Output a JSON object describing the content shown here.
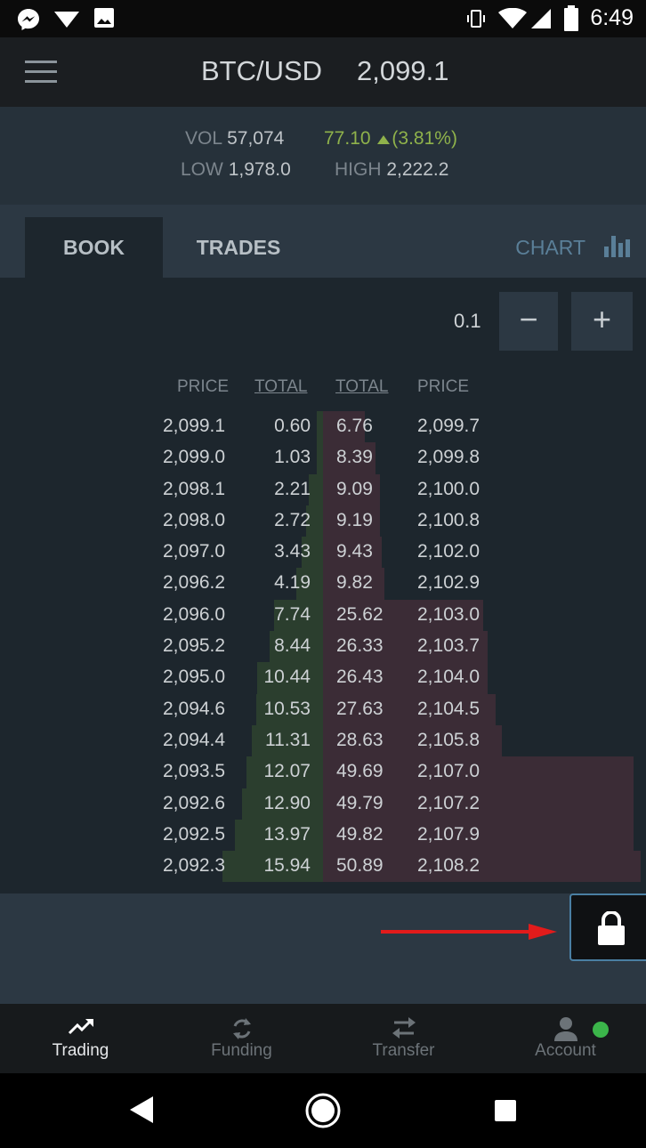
{
  "status_bar": {
    "time": "6:49"
  },
  "header": {
    "pair": "BTC/USD",
    "last_price": "2,099.1"
  },
  "stats": {
    "vol_label": "VOL",
    "vol_value": "57,074",
    "change": "77.10",
    "change_pct": "(3.81%)",
    "low_label": "LOW",
    "low_value": "1,978.0",
    "high_label": "HIGH",
    "high_value": "2,222.2"
  },
  "tabs": {
    "book": "BOOK",
    "trades": "TRADES",
    "chart": "CHART"
  },
  "precision": {
    "value": "0.1",
    "minus": "−",
    "plus": "+"
  },
  "columns": {
    "bid_price": "PRICE",
    "bid_total": "TOTAL",
    "ask_total": "TOTAL",
    "ask_price": "PRICE"
  },
  "order_book": [
    {
      "bid_price": "2,099.1",
      "bid_total": "0.60",
      "ask_total": "6.76",
      "ask_price": "2,099.7"
    },
    {
      "bid_price": "2,099.0",
      "bid_total": "1.03",
      "ask_total": "8.39",
      "ask_price": "2,099.8"
    },
    {
      "bid_price": "2,098.1",
      "bid_total": "2.21",
      "ask_total": "9.09",
      "ask_price": "2,100.0"
    },
    {
      "bid_price": "2,098.0",
      "bid_total": "2.72",
      "ask_total": "9.19",
      "ask_price": "2,100.8"
    },
    {
      "bid_price": "2,097.0",
      "bid_total": "3.43",
      "ask_total": "9.43",
      "ask_price": "2,102.0"
    },
    {
      "bid_price": "2,096.2",
      "bid_total": "4.19",
      "ask_total": "9.82",
      "ask_price": "2,102.9"
    },
    {
      "bid_price": "2,096.0",
      "bid_total": "7.74",
      "ask_total": "25.62",
      "ask_price": "2,103.0"
    },
    {
      "bid_price": "2,095.2",
      "bid_total": "8.44",
      "ask_total": "26.33",
      "ask_price": "2,103.7"
    },
    {
      "bid_price": "2,095.0",
      "bid_total": "10.44",
      "ask_total": "26.43",
      "ask_price": "2,104.0"
    },
    {
      "bid_price": "2,094.6",
      "bid_total": "10.53",
      "ask_total": "27.63",
      "ask_price": "2,104.5"
    },
    {
      "bid_price": "2,094.4",
      "bid_total": "11.31",
      "ask_total": "28.63",
      "ask_price": "2,105.8"
    },
    {
      "bid_price": "2,093.5",
      "bid_total": "12.07",
      "ask_total": "49.69",
      "ask_price": "2,107.0"
    },
    {
      "bid_price": "2,092.6",
      "bid_total": "12.90",
      "ask_total": "49.79",
      "ask_price": "2,107.2"
    },
    {
      "bid_price": "2,092.5",
      "bid_total": "13.97",
      "ask_total": "49.82",
      "ask_price": "2,107.9"
    },
    {
      "bid_price": "2,092.3",
      "bid_total": "15.94",
      "ask_total": "50.89",
      "ask_price": "2,108.2"
    }
  ],
  "bottom_nav": [
    {
      "label": "Trading",
      "icon": "trending-up-icon",
      "active": true
    },
    {
      "label": "Funding",
      "icon": "refresh-icon",
      "active": false
    },
    {
      "label": "Transfer",
      "icon": "swap-icon",
      "active": false
    },
    {
      "label": "Account",
      "icon": "person-icon",
      "active": false
    }
  ],
  "colors": {
    "bid_bar": "#2b3e2e",
    "ask_bar": "#3b2c36",
    "change_up": "#8fb24b",
    "online_dot": "#3bb54a",
    "annotation_arrow": "#e21b1b"
  }
}
